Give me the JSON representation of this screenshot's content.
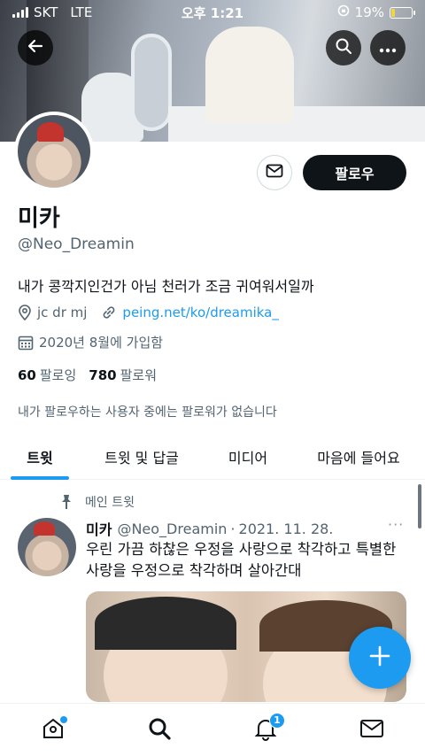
{
  "status_bar": {
    "carrier": "SKT",
    "network": "LTE",
    "time": "오후 1:21",
    "battery_percent": "19%",
    "battery_level": 0.19,
    "battery_color": "#f5d547"
  },
  "header": {
    "back_icon": "arrow-left-icon",
    "search_icon": "search-icon",
    "more_icon": "more-horizontal-icon"
  },
  "profile": {
    "display_name": "미카",
    "handle": "@Neo_Dreamin",
    "bio": "내가 콩깍지인건가 아님 천러가 조금 귀여워서일까",
    "location": "jc dr mj",
    "website": "peing.net/ko/dreamika_",
    "joined": "2020년 8월에 가입함",
    "following_count": "60",
    "following_label": "팔로잉",
    "followers_count": "780",
    "followers_label": "팔로워",
    "follow_note": "내가 팔로우하는 사용자 중에는 팔로워가 없습니다",
    "follow_button": "팔로우",
    "message_icon": "mail-icon"
  },
  "tabs": [
    {
      "label": "트윗",
      "active": true
    },
    {
      "label": "트윗 및 답글",
      "active": false
    },
    {
      "label": "미디어",
      "active": false
    },
    {
      "label": "마음에 들어요",
      "active": false
    }
  ],
  "tweet": {
    "pinned_label": "메인 트윗",
    "name": "미카",
    "handle": "@Neo_Dreamin",
    "separator": "·",
    "date": "2021. 11. 28.",
    "more": "···",
    "text": "우린 가끔 하찮은 우정을 사랑으로 착각하고 특별한 사랑을 우정으로 착각하며 살아간대"
  },
  "bottom_nav": {
    "items": [
      "home-icon",
      "search-icon",
      "notifications-icon",
      "messages-icon"
    ],
    "notification_badge": "1"
  },
  "colors": {
    "accent": "#1d9bf0",
    "text": "#0f1419",
    "secondary": "#536471"
  }
}
